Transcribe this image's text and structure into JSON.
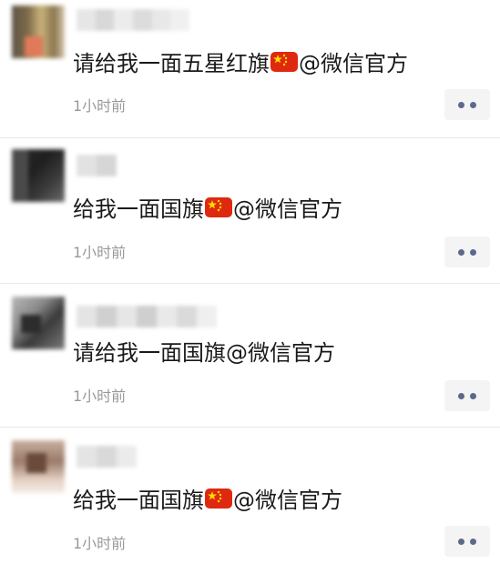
{
  "posts": [
    {
      "text_before": "请给我一面五星红旗",
      "has_flag": true,
      "mention": "@微信官方",
      "time": "1小时前",
      "more_icon": "ellipsis-icon"
    },
    {
      "text_before": "给我一面国旗",
      "has_flag": true,
      "mention": "@微信官方",
      "time": "1小时前",
      "more_icon": "ellipsis-icon"
    },
    {
      "text_before": "请给我一面国旗",
      "has_flag": false,
      "mention": "@微信官方",
      "time": "1小时前",
      "more_icon": "ellipsis-icon"
    },
    {
      "text_before": "给我一面国旗",
      "has_flag": true,
      "mention": "@微信官方",
      "time": "1小时前",
      "more_icon": "ellipsis-icon"
    }
  ],
  "colors": {
    "flag_red": "#de2910",
    "flag_star": "#ffde00",
    "time_text": "#999999",
    "more_dots": "#5a6a8a"
  }
}
